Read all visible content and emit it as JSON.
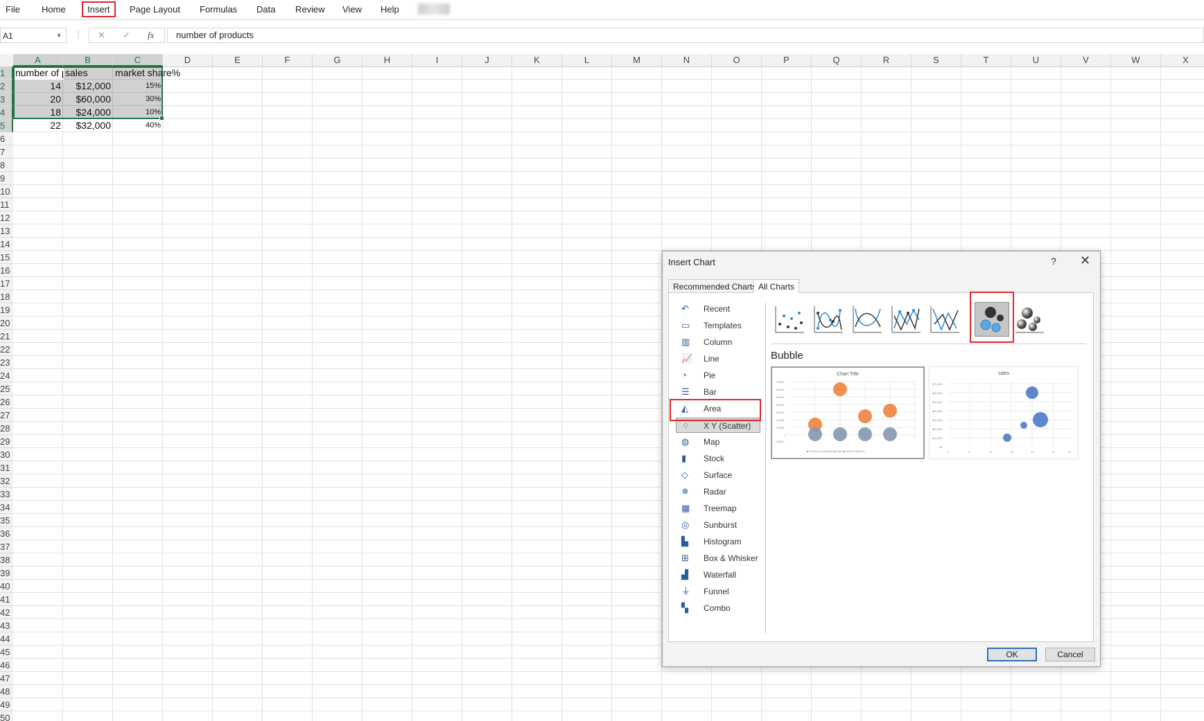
{
  "menu": {
    "items": [
      "File",
      "Home",
      "Insert",
      "Page Layout",
      "Formulas",
      "Data",
      "Review",
      "View",
      "Help"
    ],
    "active": "Insert"
  },
  "formula_bar": {
    "name_box": "A1",
    "fx": "fx",
    "content": "number of products"
  },
  "columns": [
    "A",
    "B",
    "C",
    "D",
    "E",
    "F",
    "G",
    "H",
    "I",
    "J",
    "K",
    "L",
    "M",
    "N",
    "O",
    "P",
    "Q",
    "R",
    "S",
    "T",
    "U",
    "V",
    "W",
    "X"
  ],
  "rows": [
    "1",
    "2",
    "3",
    "4",
    "5",
    "6",
    "7",
    "8",
    "9",
    "10",
    "11",
    "12",
    "13",
    "14",
    "15",
    "16",
    "17",
    "18",
    "19",
    "20",
    "21",
    "22",
    "23",
    "24",
    "25",
    "26",
    "27",
    "28",
    "29",
    "30",
    "31",
    "32",
    "33",
    "34",
    "35",
    "36",
    "37",
    "38",
    "39",
    "40",
    "41",
    "42",
    "43",
    "44",
    "45",
    "46",
    "47",
    "48",
    "49",
    "50"
  ],
  "sheet": {
    "headers": [
      "number of products",
      "sales",
      "market share%"
    ],
    "rows": [
      [
        "14",
        "$12,000",
        "15%"
      ],
      [
        "20",
        "$60,000",
        "30%"
      ],
      [
        "18",
        "$24,000",
        "10%"
      ],
      [
        "22",
        "$32,000",
        "40%"
      ]
    ]
  },
  "dialog": {
    "title": "Insert Chart",
    "help": "?",
    "close": "✕",
    "tabs": [
      "Recommended Charts",
      "All Charts"
    ],
    "active_tab": "All Charts",
    "categories": [
      "Recent",
      "Templates",
      "Column",
      "Line",
      "Pie",
      "Bar",
      "Area",
      "X Y (Scatter)",
      "Map",
      "Stock",
      "Surface",
      "Radar",
      "Treemap",
      "Sunburst",
      "Histogram",
      "Box & Whisker",
      "Waterfall",
      "Funnel",
      "Combo"
    ],
    "selected_category": "X Y (Scatter)",
    "subtype_name": "Bubble",
    "preview_titles": [
      "Chart Title",
      "sales"
    ],
    "ok_label": "OK",
    "cancel_label": "Cancel"
  },
  "accent_colors": {
    "excel_green": "#217346",
    "highlight_red": "#e0262b",
    "bubble_orange": "#ed7d31",
    "bubble_gray": "#8497b0",
    "bubble_blue": "#4472c4"
  }
}
